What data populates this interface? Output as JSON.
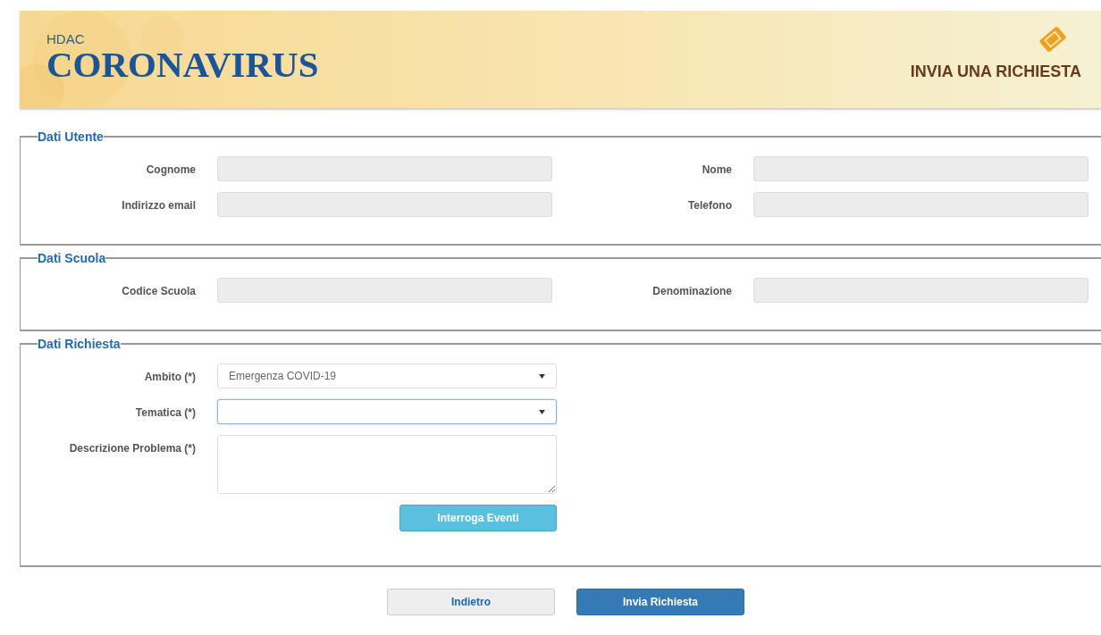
{
  "header": {
    "subtitle": "HDAC",
    "title": "CORONAVIRUS",
    "action": "INVIA UNA RICHIESTA"
  },
  "sections": [
    {
      "title": "Dati Utente",
      "rows": [
        [
          {
            "label": "Cognome",
            "kind": "text",
            "disabled": true
          },
          {
            "label": "Nome",
            "kind": "text",
            "disabled": true
          }
        ],
        [
          {
            "label": "Indirizzo email",
            "kind": "text",
            "disabled": true
          },
          {
            "label": "Telefono",
            "kind": "text",
            "disabled": true
          }
        ]
      ]
    },
    {
      "title": "Dati Scuola",
      "rows": [
        [
          {
            "label": "Codice Scuola",
            "kind": "text",
            "disabled": true
          },
          {
            "label": "Denominazione",
            "kind": "text",
            "disabled": true
          }
        ]
      ]
    },
    {
      "title": "Dati Richiesta",
      "rows": [
        [
          {
            "label": "Ambito (*)",
            "kind": "select",
            "value": "Emergenza COVID-19",
            "focused": false
          }
        ],
        [
          {
            "label": "Tematica (*)",
            "kind": "select",
            "focused": true
          }
        ],
        [
          {
            "label": "Descrizione Problema (*)",
            "kind": "textarea"
          }
        ]
      ],
      "button": "Interroga Eventi"
    }
  ],
  "buttons": [
    {
      "label": "Indietro",
      "kind": "secondary"
    },
    {
      "label": "Invia Richiesta",
      "kind": "primary"
    }
  ]
}
